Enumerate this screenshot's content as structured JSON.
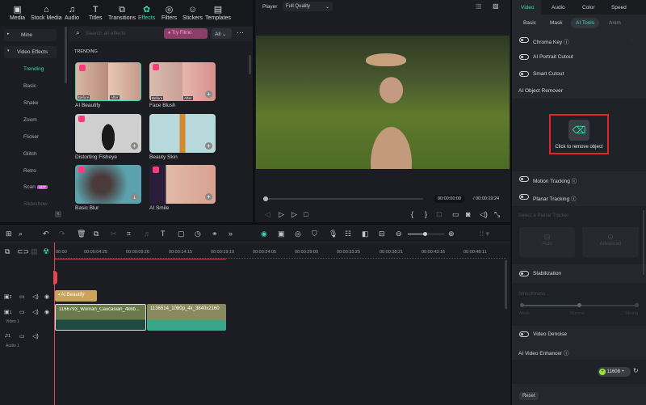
{
  "toolbar": {
    "items": [
      {
        "label": "Media",
        "icon": "media-icon"
      },
      {
        "label": "Stock Media",
        "icon": "stock-media-icon"
      },
      {
        "label": "Audio",
        "icon": "audio-icon"
      },
      {
        "label": "Titles",
        "icon": "titles-icon"
      },
      {
        "label": "Transitions",
        "icon": "transitions-icon"
      },
      {
        "label": "Effects",
        "icon": "effects-icon",
        "active": true
      },
      {
        "label": "Filters",
        "icon": "filters-icon"
      },
      {
        "label": "Stickers",
        "icon": "stickers-icon"
      },
      {
        "label": "Templates",
        "icon": "templates-icon"
      }
    ]
  },
  "sidebar": {
    "mine": "Mine",
    "video_effects": "Video Effects",
    "items": [
      "Trending",
      "Basic",
      "Shake",
      "Zoom",
      "Flicker",
      "Glitch",
      "Retro",
      "Scan",
      "Slideshow"
    ],
    "hot_badge": "HOT"
  },
  "effects": {
    "search_placeholder": "Search all effects",
    "promo": "Try Filmo",
    "filter": "All",
    "section": "TRENDING",
    "before": "Before",
    "after": "After",
    "cards": [
      "AI Beautify",
      "Face Blush",
      "Distorting Fisheye",
      "Beauty Skin",
      "Basic Blur",
      "AI Smile"
    ]
  },
  "player": {
    "label": "Player",
    "quality": "Full Quality",
    "current_time": "00:00:00:00",
    "total_time": "/ 00:00:19:24"
  },
  "right_panel": {
    "tabs": [
      "Video",
      "Audio",
      "Color",
      "Speed"
    ],
    "subtabs": [
      "Basic",
      "Mask",
      "AI Tools",
      "Anim"
    ],
    "chroma_key": "Chroma Key",
    "portrait_cutout": "AI Portrait Cutout",
    "smart_cutout": "Smart Cutout",
    "object_remover": "AI Object Remover",
    "remove_object": "Click to remove object",
    "motion_tracking": "Motion Tracking",
    "planar_tracking": "Planar Tracking",
    "select_planar": "Select a Planar Tracker",
    "auto": "Auto",
    "advanced": "Advanced",
    "stabilization": "Stabilization",
    "smoothness": "Smoothness",
    "weak": "Weak",
    "normal": "Normal",
    "strong": "Strong",
    "video_denoise": "Video Denoise",
    "video_enhancer": "AI Video Enhancer",
    "credits": "11608",
    "reset": "Reset"
  },
  "timeline": {
    "ruler": [
      "00:00",
      "00:00:04:25",
      "00:00:09:20",
      "00:00:14:15",
      "00:00:19:10",
      "00:00:24:05",
      "00:00:29:00",
      "00:00:33:25",
      "00:00:38:21",
      "00:00:43:16",
      "00:00:48:11"
    ],
    "effect_clip": "AI Beautify",
    "clip1": "1166793_Woman_Caucasian_4k6b...",
    "clip2": "1136514_1080p_4k_3840x2160",
    "track2": "2",
    "track1": "1",
    "video1": "Video 1",
    "audio_track": "1",
    "audio1": "Audio 1"
  },
  "colors": {
    "accent": "#3dd6b4",
    "highlight": "#e0262b",
    "playhead": "#e2474f"
  }
}
